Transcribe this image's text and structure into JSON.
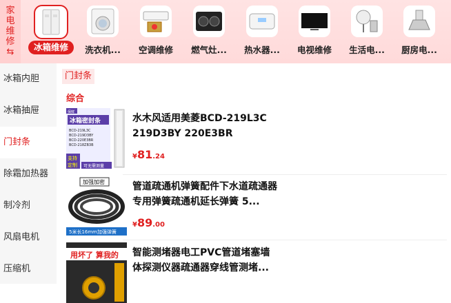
{
  "top_label": [
    "家",
    "电",
    "维",
    "修"
  ],
  "menu_icon": "⇆",
  "categories": [
    {
      "label": "冰箱维修",
      "icon": "fridge-icon"
    },
    {
      "label": "洗衣机...",
      "icon": "washer-icon"
    },
    {
      "label": "空调维修",
      "icon": "aircon-icon"
    },
    {
      "label": "燃气灶...",
      "icon": "stove-icon"
    },
    {
      "label": "热水器...",
      "icon": "water-heater-icon"
    },
    {
      "label": "电视维修",
      "icon": "tv-icon"
    },
    {
      "label": "生活电...",
      "icon": "fan-icon"
    },
    {
      "label": "厨房电...",
      "icon": "range-hood-icon"
    }
  ],
  "sidebar": [
    "冰箱内胆",
    "冰箱抽屉",
    "门封条",
    "除霜加热器",
    "制冷剂",
    "风扇电机",
    "压缩机"
  ],
  "breadcrumb": "门封条",
  "section": "综合",
  "products": [
    {
      "title": "水木风适用美菱BCD-219L3C 219D3BY 220E3BR 218ZB3B...",
      "currency": "¥",
      "price_int": "81",
      "price_dec": ".24",
      "thumb_texts": [
        "保鲜",
        "冰箱密封条",
        "BCD-219L3C",
        "BCD-219D3BY",
        "BCD-220E3BR",
        "BCD-218ZB3B",
        "支持",
        "定制",
        "可无需测量"
      ]
    },
    {
      "title": "管道疏通机弹簧配件下水道疏通器专用弹簧疏通机延长弹簧 5...",
      "currency": "¥",
      "price_int": "89",
      "price_dec": ".00",
      "thumb_texts": [
        "加强加密",
        "5米长16mm加强弹簧"
      ]
    },
    {
      "title": "智能测堵器电工PVC管道堵塞墙体探测仪器疏通器穿线管测堵...",
      "currency": "¥",
      "price_int": "",
      "price_dec": "",
      "thumb_texts": [
        "用坏了 算我的"
      ]
    }
  ],
  "colors": {
    "accent": "#e02020",
    "top_bg": "#ffe3e3",
    "sidebar_bg": "#f6f6f6"
  }
}
